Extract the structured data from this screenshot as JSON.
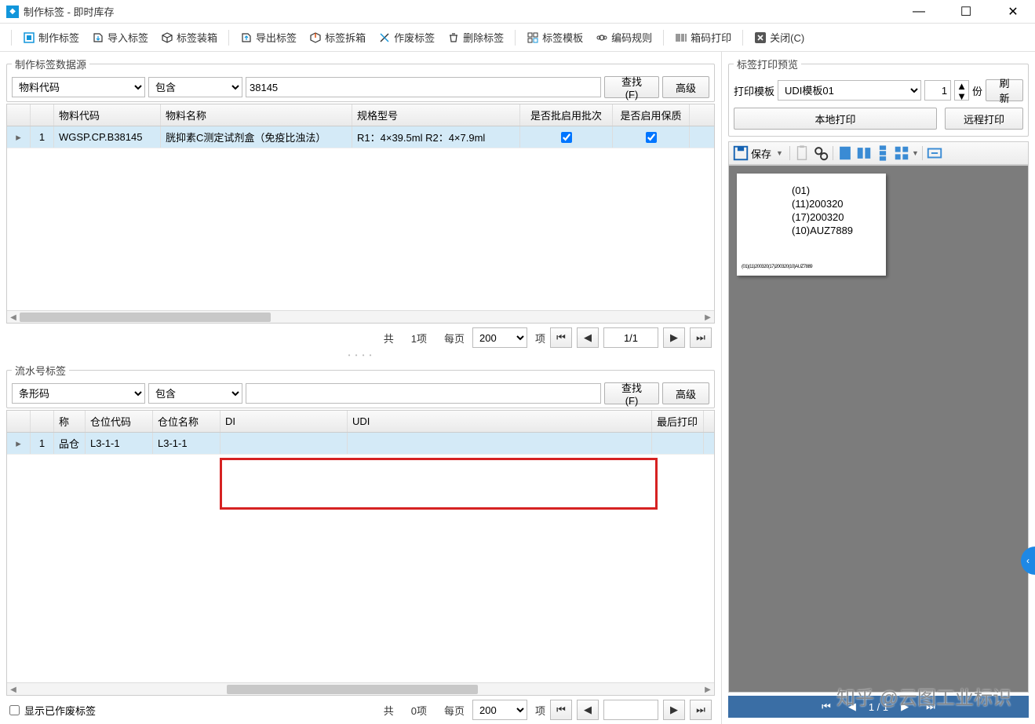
{
  "window": {
    "title": "制作标签 - 即时库存"
  },
  "toolbar": {
    "make": "制作标签",
    "import": "导入标签",
    "box": "标签装箱",
    "export": "导出标签",
    "unbox": "标签拆箱",
    "void": "作废标签",
    "delete": "删除标签",
    "template": "标签模板",
    "rule": "编码规则",
    "print": "箱码打印",
    "close": "关闭(C)"
  },
  "ds": {
    "legend": "制作标签数据源",
    "field": "物料代码",
    "op": "包含",
    "value": "38145",
    "find": "查找(F)",
    "adv": "高级",
    "cols": {
      "idx": "",
      "code": "物料代码",
      "name": "物料名称",
      "spec": "规格型号",
      "batch": "是否批启用批次",
      "qa": "是否启用保质"
    },
    "row": {
      "idx": "1",
      "code": "WGSP.CP.B38145",
      "name": "胱抑素C测定试剂盒（免疫比浊法）",
      "spec": "R1：4×39.5ml  R2：4×7.9ml"
    }
  },
  "pager": {
    "total_label": "共",
    "count": "1项",
    "per": "每页",
    "size": "200",
    "unit": "项",
    "page": "1/1"
  },
  "serial": {
    "legend": "流水号标签",
    "field": "条形码",
    "op": "包含",
    "value": "",
    "find": "查找(F)",
    "adv": "高级",
    "cols": {
      "idx": "",
      "name": "称",
      "loccode": "仓位代码",
      "locname": "仓位名称",
      "di": "DI",
      "udi": "UDI",
      "last": "最后打印"
    },
    "row": {
      "idx": "1",
      "name": "品仓",
      "loccode": "L3-1-1",
      "locname": "L3-1-1",
      "di": "",
      "udi": ""
    }
  },
  "pager2": {
    "total_label": "共",
    "count": "0项",
    "per": "每页",
    "size": "200",
    "unit": "项",
    "page": ""
  },
  "showvoid": "显示已作废标签",
  "preview": {
    "legend": "标签打印预览",
    "tpl_label": "打印模板",
    "tpl": "UDI模板01",
    "copies": "1",
    "copies_unit": "份",
    "refresh": "刷新",
    "local": "本地打印",
    "remote": "远程打印",
    "save": "保存",
    "lines": [
      "(01)",
      "(11)200320",
      "(17)200320",
      "(10)AUZ7889"
    ],
    "barcode": "(01)(11)200320(17)200320(10)AUZ7889",
    "nav": "1 / 1"
  },
  "watermark": "知乎 @云图工业标识"
}
